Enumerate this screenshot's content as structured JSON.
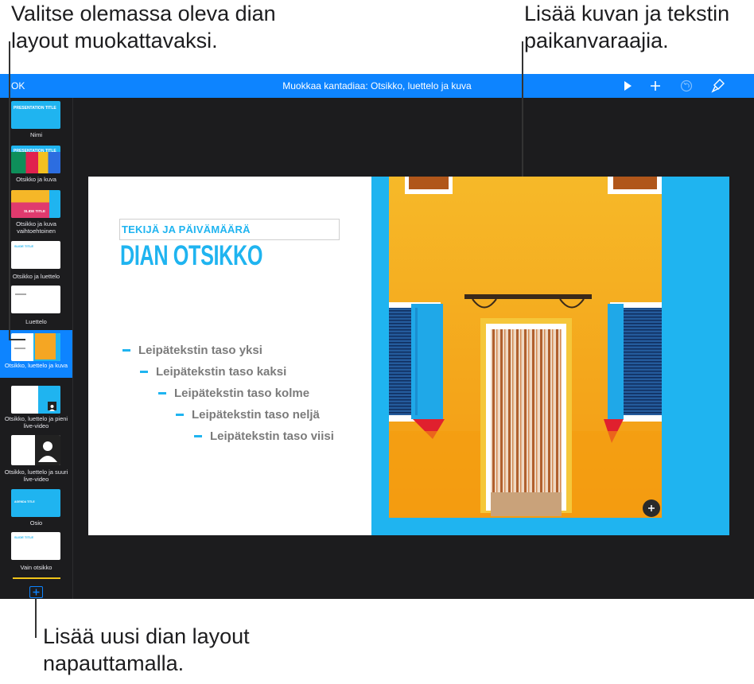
{
  "callouts": {
    "top_left": [
      "Valitse olemassa oleva dian",
      "layout muokattavaksi."
    ],
    "top_right": [
      "Lisää kuvan ja tekstin",
      "paikanvaraajia."
    ],
    "bottom": [
      "Lisää uusi dian layout",
      "napauttamalla."
    ]
  },
  "toolbar": {
    "ok_label": "OK",
    "title": "Muokkaa kantadiaa: Otsikko, luettelo ja kuva",
    "icons": [
      "play-icon",
      "add-icon",
      "undo-icon",
      "format-brush-icon"
    ]
  },
  "sidebar": {
    "items": [
      {
        "label": "Nimi",
        "thumb_text": "PRESENTATION TITLE"
      },
      {
        "label": "Otsikko ja kuva",
        "thumb_text": "PRESENTATION TITLE"
      },
      {
        "label": "Otsikko ja kuva vaihtoehtoinen",
        "thumb_text": "SLIDE TITLE"
      },
      {
        "label": "Otsikko ja luettelo",
        "thumb_text": "SLIDE TITLE"
      },
      {
        "label": "Luettelo",
        "thumb_text": ""
      },
      {
        "label": "Otsikko, luettelo ja kuva",
        "thumb_text": ""
      },
      {
        "label": "Otsikko, luettelo ja pieni live-video",
        "thumb_text": ""
      },
      {
        "label": "Otsikko, luettelo ja suuri live-video",
        "thumb_text": ""
      },
      {
        "label": "Osio",
        "thumb_text": "AGENDA TITLE"
      },
      {
        "label": "Vain otsikko",
        "thumb_text": "SLIDE TITLE"
      }
    ],
    "selected_index": 5
  },
  "slide": {
    "author": "TEKIJÄ JA PÄIVÄMÄÄRÄ",
    "title": "DIAN OTSIKKO",
    "bullets": [
      "Leipätekstin taso yksi",
      "Leipätekstin taso kaksi",
      "Leipätekstin taso kolme",
      "Leipätekstin taso neljä",
      "Leipätekstin taso viisi"
    ]
  },
  "colors": {
    "toolbar": "#0d84ff",
    "accent": "#1fb4f0",
    "dark_bg": "#1c1c1e",
    "wall": "#f7a21b"
  }
}
